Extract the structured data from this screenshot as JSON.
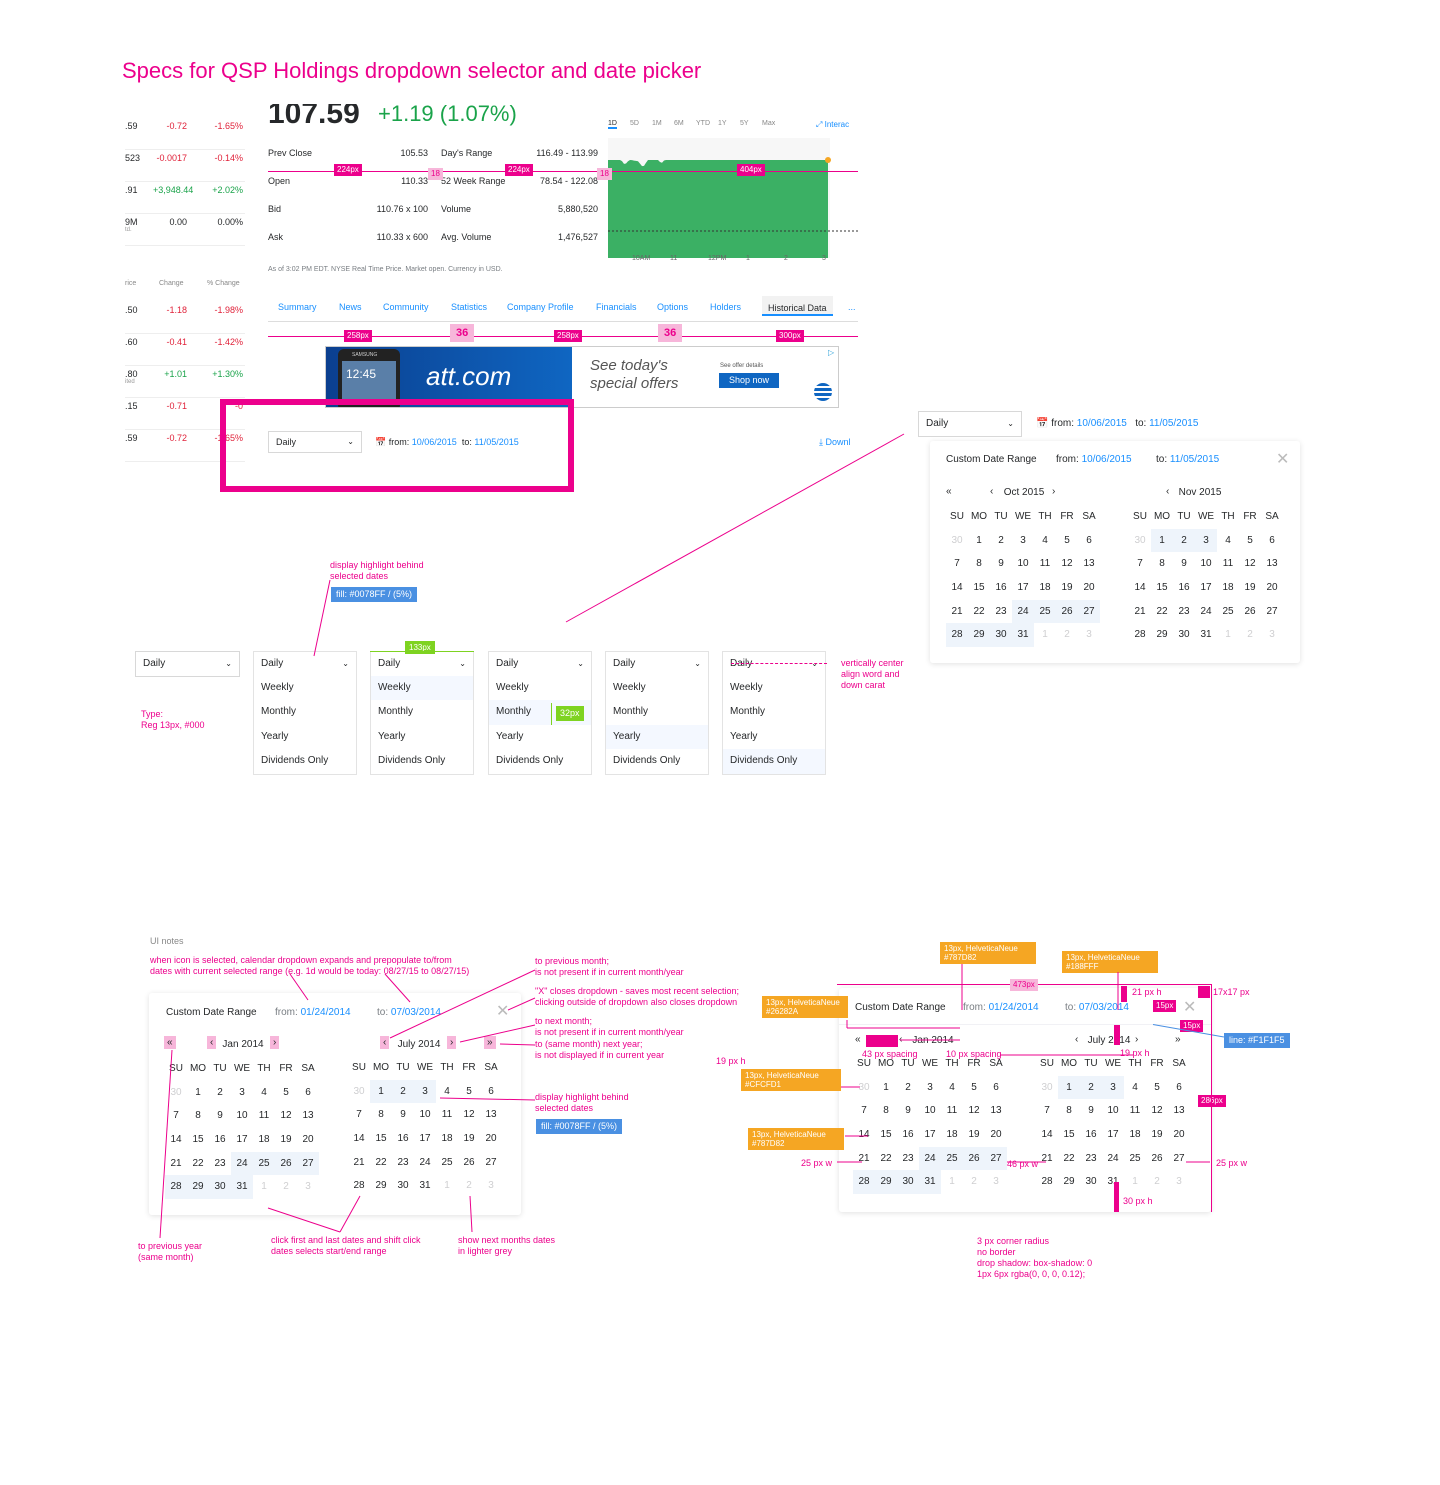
{
  "title": "Specs for QSP Holdings dropdown selector and date picker",
  "colors": {
    "accent": "#ec008c",
    "link": "#188FFF",
    "text": "#26282A",
    "muted": "#787D82",
    "light": "#CFCFD1",
    "range_fill": "#0078FF0D",
    "line": "#F1F1F5",
    "up": "#1aa34a",
    "down": "#e0223a"
  },
  "quote_table_top": [
    {
      "a": ".59",
      "b": "-0.72",
      "c": "-1.65%",
      "bc": "down"
    },
    {
      "a": "523",
      "b": "-0.0017",
      "c": "-0.14%",
      "bc": "down"
    },
    {
      "a": ".91",
      "b": "+3,948.44",
      "c": "+2.02%",
      "bc": "up"
    },
    {
      "a": "9M",
      "a2": "td.",
      "b": "0.00",
      "c": "0.00%",
      "bc": "flat"
    }
  ],
  "quote_table_bottom_header": {
    "a": "rice",
    "b": "Change",
    "c": "% Change"
  },
  "quote_table_bottom": [
    {
      "a": ".50",
      "b": "-1.18",
      "c": "-1.98%",
      "bc": "down"
    },
    {
      "a": ".60",
      "b": "-0.41",
      "c": "-1.42%",
      "bc": "down"
    },
    {
      "a": ".80",
      "a2": "ited",
      "b": "+1.01",
      "c": "+1.30%",
      "bc": "up"
    },
    {
      "a": ".15",
      "b": "-0.71",
      "c": "-0",
      "bc": "down"
    },
    {
      "a": ".59",
      "b": "-0.72",
      "c": "-1.65%",
      "bc": "down"
    }
  ],
  "quote": {
    "price": "107.59",
    "change": "+1.19 (1.07%)",
    "stats": [
      {
        "l1": "Prev Close",
        "v1": "105.53",
        "l2": "Day's Range",
        "v2": "116.49 - 113.99"
      },
      {
        "l1": "Open",
        "v1": "110.33",
        "l2": "52 Week Range",
        "v2": "78.54 - 122.08"
      },
      {
        "l1": "Bid",
        "v1": "110.76 x 100",
        "l2": "Volume",
        "v2": "5,880,520"
      },
      {
        "l1": "Ask",
        "v1": "110.33 x 600",
        "l2": "Avg. Volume",
        "v2": "1,476,527"
      }
    ],
    "footnote": "As of 3:02 PM EDT.  NYSE Real Time Price. Market open. Currency in USD.",
    "ranges": [
      "1D",
      "5D",
      "1M",
      "6M",
      "YTD",
      "1Y",
      "5Y",
      "Max"
    ],
    "interactive": "Interac",
    "chart_x": [
      "10AM",
      "11",
      "12PM",
      "1",
      "2",
      "3"
    ],
    "tabs": [
      "Summary",
      "News",
      "Community",
      "Statistics",
      "Company Profile",
      "Financials",
      "Options",
      "Holders",
      "Historical Data",
      "..."
    ]
  },
  "ad": {
    "brand": "att.com",
    "tagline1": "See today's",
    "tagline2": "special offers",
    "offer": "See offer details",
    "cta": "Shop now",
    "phone": "12:45",
    "phone_brand": "SAMSUNG"
  },
  "spec_tags": {
    "w224": "224px",
    "w224b": "224px",
    "g18": "18",
    "g18b": "18",
    "w404": "404px",
    "w258": "258px",
    "s36": "36",
    "w258b": "258px",
    "s36b": "36",
    "w300": "300px"
  },
  "toolbar": {
    "period": "Daily",
    "from_label": "from:",
    "from_value": "10/06/2015",
    "to_label": "to:",
    "to_value": "11/05/2015",
    "download": "Downl"
  },
  "cal1": {
    "title": "Custom Date Range",
    "from_label": "from:",
    "from_value": "10/06/2015",
    "to_label": "to:",
    "to_value": "11/05/2015",
    "left_month": "Oct 2015",
    "right_month": "Nov 2015",
    "dow": [
      "SU",
      "MO",
      "TU",
      "WE",
      "TH",
      "FR",
      "SA"
    ],
    "left_days": [
      "30",
      "1",
      "2",
      "3",
      "4",
      "5",
      "6",
      "7",
      "8",
      "9",
      "10",
      "11",
      "12",
      "13",
      "14",
      "15",
      "16",
      "17",
      "18",
      "19",
      "20",
      "21",
      "22",
      "23",
      "24",
      "25",
      "26",
      "27",
      "28",
      "29",
      "30",
      "31",
      "1",
      "2",
      "3"
    ],
    "right_days": [
      "30",
      "1",
      "2",
      "3",
      "4",
      "5",
      "6",
      "7",
      "8",
      "9",
      "10",
      "11",
      "12",
      "13",
      "14",
      "15",
      "16",
      "17",
      "18",
      "19",
      "20",
      "21",
      "22",
      "23",
      "24",
      "25",
      "26",
      "27",
      "28",
      "29",
      "30",
      "31",
      "1",
      "2",
      "3"
    ]
  },
  "dropdown": {
    "options": [
      "Daily",
      "Weekly",
      "Monthly",
      "Yearly",
      "Dividends Only"
    ]
  },
  "dd_notes": {
    "highlight": "display highlight behind\nselected dates",
    "fill": "fill: #0078FF /  (5%)",
    "w133": "133px",
    "h32": "32px",
    "type": "Type:\nReg 13px, #000",
    "valign": "vertically center\nalign word and\ndown carat"
  },
  "cal2": {
    "title": "Custom Date Range",
    "from_label": "from:",
    "from_value": "01/24/2014",
    "to_label": "to:",
    "to_value": "07/03/2014",
    "left_month": "Jan 2014",
    "right_month": "July 2014",
    "dow": [
      "SU",
      "MO",
      "TU",
      "WE",
      "TH",
      "FR",
      "SA"
    ],
    "left_days": [
      "30",
      "1",
      "2",
      "3",
      "4",
      "5",
      "6",
      "7",
      "8",
      "9",
      "10",
      "11",
      "12",
      "13",
      "14",
      "15",
      "16",
      "17",
      "18",
      "19",
      "20",
      "21",
      "22",
      "23",
      "24",
      "25",
      "26",
      "27",
      "28",
      "29",
      "30",
      "31",
      "1",
      "2",
      "3"
    ],
    "right_days": [
      "30",
      "1",
      "2",
      "3",
      "4",
      "5",
      "6",
      "7",
      "8",
      "9",
      "10",
      "11",
      "12",
      "13",
      "14",
      "15",
      "16",
      "17",
      "18",
      "19",
      "20",
      "21",
      "22",
      "23",
      "24",
      "25",
      "26",
      "27",
      "28",
      "29",
      "30",
      "31",
      "1",
      "2",
      "3"
    ]
  },
  "cal3": {
    "title": "Custom Date Range",
    "from_label": "from:",
    "from_value": "01/24/2014",
    "to_label": "to:",
    "to_value": "07/03/2014",
    "left_month": "Jan 2014",
    "right_month": "July 2014"
  },
  "ui_notes": {
    "heading": "UI notes",
    "expand": "when icon is selected, calendar dropdown expands and prepopulate to/from\ndates with current selected range (e.g. 1d would be today: 08/27/15 to 08/27/15)",
    "prev_month": "to previous month;\nis not present if in current month/year",
    "x_close": "\"X\" closes dropdown - saves most recent selection;\nclicking outside of dropdown also closes dropdown",
    "next_month": "to next month;\nis not present if in current month/year",
    "next_year": "to (same month) next year;\nis not displayed if in current year",
    "highlight": "display highlight behind\nselected dates",
    "fill": "fill: #0078FF /  (5%)",
    "prev_year": "to previous year\n(same month)",
    "click_range": "click first and last dates and shift click\ndates selects start/end range",
    "next_dates": "show next months dates\nin lighter grey"
  },
  "spec_notes": {
    "o1": "13px, HelveticaNeue\n#787D82",
    "o2": "13px, HelveticaNeue\n#188FFF",
    "o3": "13px, HelveticaNeue\n#26282A",
    "o4": "13px, HelveticaNeue\n#CFCFD1",
    "o5": "13px, HelveticaNeue\n#787D82",
    "w473": "473px",
    "h21": "21 px h",
    "s17": "17x17 px",
    "p15": "15px",
    "p15b": "15px",
    "line": "line: #F1F1F5",
    "sp43": "43 px spacing",
    "sp10": "10 px spacing",
    "h19": "19 px h",
    "h19b": "19 px h",
    "h286": "286px",
    "w25": "25 px w",
    "w46": "46 px w",
    "w25b": "25 px w",
    "h30": "30 px h",
    "corner": "3 px corner radius\nno border\ndrop shadow: box-shadow: 0\n1px 6px rgba(0, 0, 0, 0.12);"
  }
}
